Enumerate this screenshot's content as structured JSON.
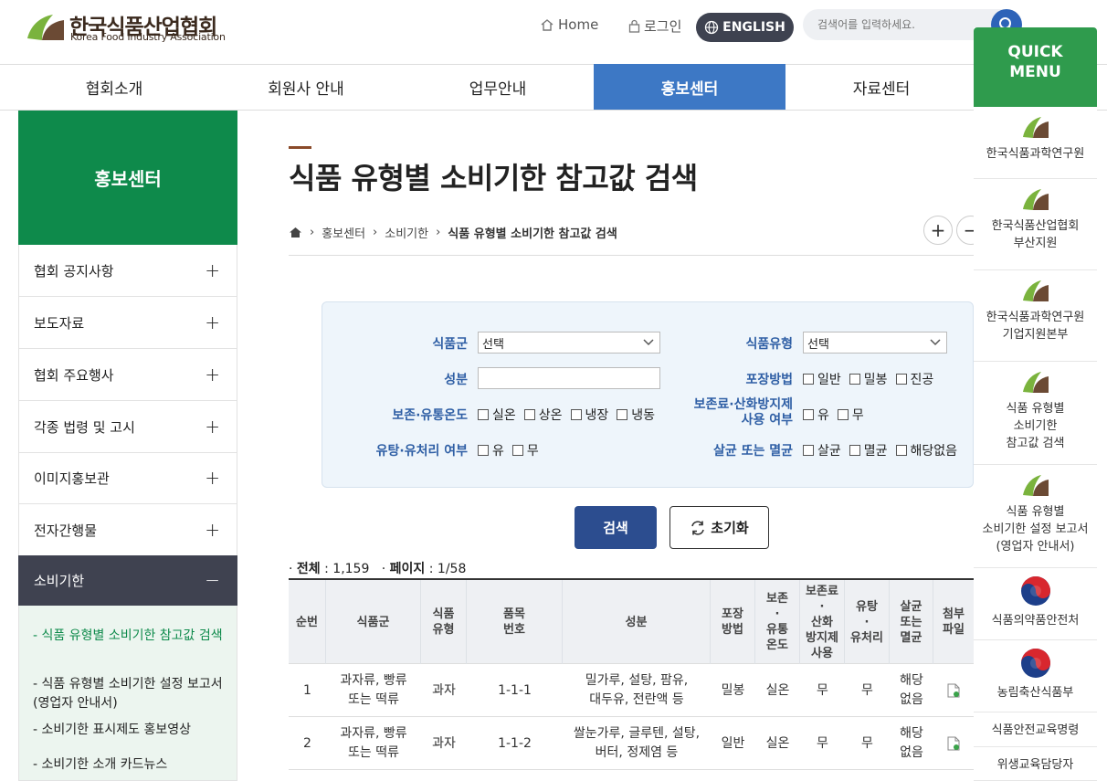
{
  "header": {
    "logo_kr": "한국식품산업협회",
    "logo_en": "Korea Food Industry Association",
    "home": "Home",
    "login": "로그인",
    "english": "ENGLISH",
    "search_placeholder": "검색어를 입력하세요."
  },
  "gnb": [
    "협회소개",
    "회원사 안내",
    "업무안내",
    "홍보센터",
    "자료센터"
  ],
  "gnb_active": "홍보센터",
  "sidebar": {
    "title": "홍보센터",
    "items": [
      "협회 공지사항",
      "보도자료",
      "협회 주요행사",
      "각종 법령 및 고시",
      "이미지홍보관",
      "전자간행물",
      "소비기한"
    ],
    "active": "소비기한",
    "sub_items": [
      "식품 유형별 소비기한 참고값 검색",
      "식품 유형별 소비기한 설정 보고서 (영업자 안내서)",
      "소비기한 표시제도 홍보영상",
      "소비기한 소개 카드뉴스"
    ]
  },
  "page": {
    "title": "식품 유형별 소비기한 참고값 검색",
    "breadcrumb": [
      "홍보센터",
      "소비기한",
      "식품 유형별 소비기한 참고값 검색"
    ]
  },
  "filter": {
    "food_group_label": "식품군",
    "food_group_value": "선택",
    "food_type_label": "식품유형",
    "food_type_value": "선택",
    "ingredient_label": "성분",
    "packaging_label": "포장방법",
    "packaging_options": [
      "일반",
      "밀봉",
      "진공"
    ],
    "temp_label": "보존·유통온도",
    "temp_options": [
      "실온",
      "상온",
      "냉장",
      "냉동"
    ],
    "preservative_label_1": "보존료·산화방지제",
    "preservative_label_2": "사용 여부",
    "preservative_options": [
      "유",
      "무"
    ],
    "milk_label": "유탕·유처리 여부",
    "milk_options": [
      "유",
      "무"
    ],
    "sterile_label": "살균 또는 멸균",
    "sterile_options": [
      "살균",
      "멸균",
      "해당없음"
    ]
  },
  "buttons": {
    "search": "검색",
    "reset": "초기화"
  },
  "count": {
    "total_label": "전체",
    "total": "1,159",
    "page_label": "페이지",
    "page": "1/58"
  },
  "table": {
    "headers": [
      "순번",
      "식품군",
      "식품\n유형",
      "품목\n번호",
      "성분",
      "포장\n방법",
      "보존\n·\n유통\n온도",
      "보존료\n·\n산화\n방지제\n사용",
      "유탕\n·\n유처리",
      "살균\n또는\n멸균",
      "첨부\n파일"
    ],
    "rows": [
      [
        "1",
        "과자류, 빵류\n또는 떡류",
        "과자",
        "1-1-1",
        "밀가루, 설탕, 팜유,\n대두유, 전란액 등",
        "밀봉",
        "실온",
        "무",
        "무",
        "해당\n없음"
      ],
      [
        "2",
        "과자류, 빵류\n또는 떡류",
        "과자",
        "1-1-2",
        "쌀눈가루, 글루텐, 설탕,\n버터, 정제염 등",
        "일반",
        "실온",
        "무",
        "무",
        "해당\n없음"
      ]
    ]
  },
  "quick_menu": {
    "title": "QUICK\nMENU",
    "items": [
      "한국식품과학연구원",
      "한국식품산업협회\n부산지원",
      "한국식품과학연구원\n기업지원본부",
      "식품 유형별\n소비기한\n참고값 검색",
      "식품 유형별\n소비기한 설정 보고서\n(영업자 안내서)",
      "식품의약품안전처",
      "농림축산식품부",
      "식품안전교육명령",
      "위생교육담당자"
    ]
  },
  "colors": {
    "brand_green": "#0e8a4b",
    "nav_blue": "#3d78c5",
    "button_navy": "#2c4d8f",
    "label_blue": "#2f5fa5"
  }
}
